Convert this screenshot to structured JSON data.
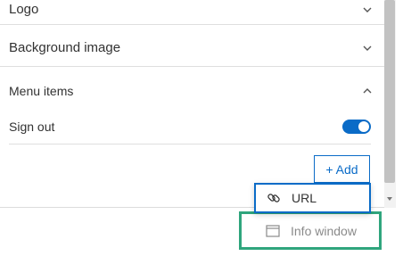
{
  "sections": {
    "logo": {
      "label": "Logo"
    },
    "background_image": {
      "label": "Background image"
    },
    "menu_items": {
      "label": "Menu items"
    }
  },
  "menu_items": {
    "rows": [
      {
        "label": "Sign out",
        "toggle_on": true
      }
    ],
    "add_button_label": "+ Add"
  },
  "add_dropdown": {
    "options": [
      {
        "label": "URL",
        "icon": "link-icon",
        "highlighted": true
      },
      {
        "label": "Info window",
        "icon": "window-icon",
        "highlighted": false
      }
    ]
  },
  "colors": {
    "accent": "#0a6bc7",
    "callout_border": "#2fa57d",
    "text": "#323232",
    "muted_text": "#8a8a8a"
  }
}
